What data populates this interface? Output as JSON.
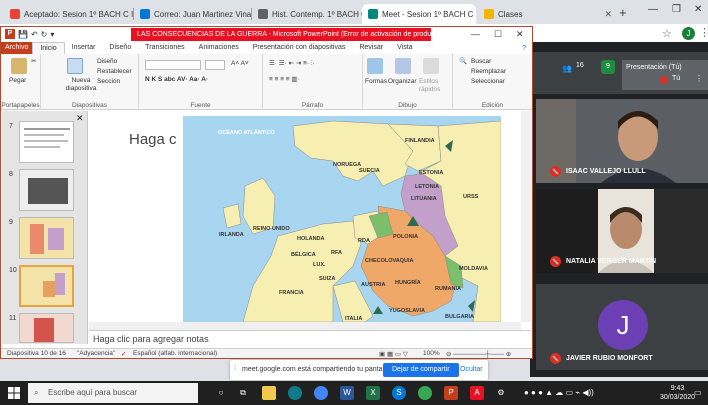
{
  "browser": {
    "tabs": [
      {
        "title": "Aceptado: Sesion 1º BACH C I",
        "favicon": "#ea4335"
      },
      {
        "title": "Correo: Juan Martinez Vinat - (",
        "favicon": "#0078d4"
      },
      {
        "title": "Hist. Contemp. 1º BACH C",
        "favicon": "#5f6368"
      },
      {
        "title": "Meet - Sesion 1º BACH C",
        "favicon": "#00897b"
      },
      {
        "title": "Clases",
        "favicon": "#f4b400"
      }
    ],
    "profile_initial": "J"
  },
  "ppt": {
    "title": "LAS CONSECUENCIAS DE LA GUERRA  -  Microsoft PowerPoint (Error de activación de productos)",
    "ribbon_tabs": [
      "Archivo",
      "Inicio",
      "Insertar",
      "Diseño",
      "Transiciones",
      "Animaciones",
      "Presentación con diapositivas",
      "Revisar",
      "Vista"
    ],
    "groups": {
      "clipboard": {
        "label": "Portapapeles",
        "paste": "Pegar"
      },
      "slides": {
        "label": "Diapositivas",
        "new_slide": "Nueva diapositiva",
        "layout": "Diseño",
        "reset": "Restablecer",
        "section": "Sección"
      },
      "font": {
        "label": "Fuente"
      },
      "paragraph": {
        "label": "Párrafo"
      },
      "drawing": {
        "label": "Dibujo",
        "shapes": "Formas",
        "arrange": "Organizar",
        "styles": "Estilos rápidos"
      },
      "editing": {
        "label": "Edición",
        "find": "Buscar",
        "replace": "Reemplazar",
        "select": "Seleccionar"
      }
    },
    "slide_numbers": [
      "7",
      "8",
      "9",
      "10",
      "11"
    ],
    "selected_slide": "10",
    "slide": {
      "bullet": "Haga c",
      "map_labels": {
        "ocean": "OCÉANO ATLÁNTICO",
        "finlandia": "FINLANDIA",
        "noruega": "NORUEGA",
        "suecia": "SUECIA",
        "estonia": "ESTONIA",
        "letonia": "LETONIA",
        "lituania": "LITUANIA",
        "urss": "URSS",
        "irlanda": "IRLANDA",
        "reino_unido": "REINO UNIDO",
        "holanda": "HOLANDA",
        "belgica": "BÉLGICA",
        "lux": "LUX.",
        "rfa": "RFA",
        "rda": "RDA",
        "polonia": "POLONIA",
        "checo": "CHECOLOVAQUIA",
        "francia": "FRANCIA",
        "suiza": "SUIZA",
        "austria": "AUSTRIA",
        "hungria": "HUNGRÍA",
        "rumania": "RUMANIA",
        "moldavia": "MOLDAVIA",
        "yugoslavia": "YUGOSLAVIA",
        "bulgaria": "BULGARIA",
        "italia": "ITALIA"
      }
    },
    "notes_placeholder": "Haga clic para agregar notas",
    "status": {
      "slide_of": "Diapositiva 10 de 16",
      "theme": "\"Adyacencia\"",
      "language": "Español (alfab. internacional)",
      "zoom": "100%"
    }
  },
  "meet": {
    "participant_count": "16",
    "chat_count": "9",
    "presenting_label": "Presentación (Tú)",
    "you_label": "Tú",
    "participants": [
      {
        "name": "ISAAC VALLEJO LLULL"
      },
      {
        "name": "NATALIA VERGER MARTÍN"
      },
      {
        "name": "JAVIER RUBIO MONFORT",
        "initial": "J"
      }
    ]
  },
  "sharebar": {
    "message": "meet.google.com está compartiendo tu pantalla.",
    "stop": "Dejar de compartir",
    "hide": "Ocultar"
  },
  "taskbar": {
    "search_placeholder": "Escribe aquí para buscar",
    "time": "9:43",
    "date": "30/03/2020"
  }
}
